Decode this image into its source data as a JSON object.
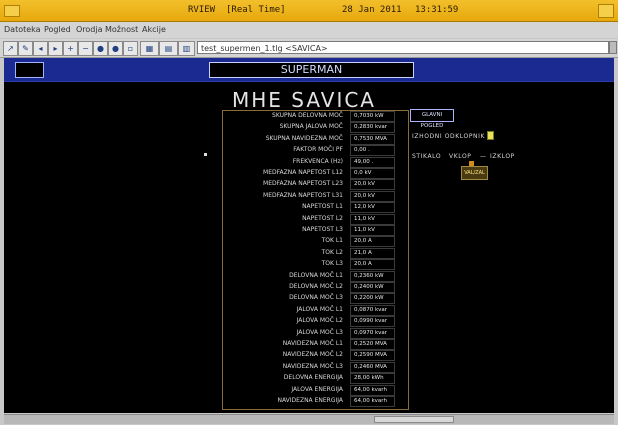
{
  "window": {
    "app": "RVIEW",
    "mode": "[Real Time]",
    "date": "28 Jan 2011",
    "time": "13:31:59"
  },
  "menu": [
    "Datoteka",
    "Pogled",
    "Orodja",
    "Možnost",
    "Akcije"
  ],
  "toolbar": {
    "path": "test_supermen_1.tlg <SAVICA>"
  },
  "header": {
    "banner": "SUPERMAN",
    "station_title": "MHE SAVICA"
  },
  "measurements": [
    {
      "label": "SKUPNA DELOVNA MOČ",
      "value": "0,7030 kW"
    },
    {
      "label": "SKUPNA JALOVA MOČ",
      "value": "0,2830 kvar"
    },
    {
      "label": "SKUPNA NAVIDEZNA MOČ",
      "value": "0,7530 MVA"
    },
    {
      "label": "FAKTOR MOČI PF",
      "value": "0,00 ."
    },
    {
      "label": "FREKVENCA (Hz)",
      "value": "49,00 ."
    },
    {
      "label": "MEDFAZNA NAPETOST L12",
      "value": "0,0 kV"
    },
    {
      "label": "MEDFAZNA NAPETOST L23",
      "value": "20,0 kV"
    },
    {
      "label": "MEDFAZNA NAPETOST L31",
      "value": "20,0 kV"
    },
    {
      "label": "NAPETOST L1",
      "value": "12,0 kV"
    },
    {
      "label": "NAPETOST L2",
      "value": "11,0 kV"
    },
    {
      "label": "NAPETOST L3",
      "value": "11,0 kV"
    },
    {
      "label": "TOK L1",
      "value": "20,0 A"
    },
    {
      "label": "TOK L2",
      "value": "21,0 A"
    },
    {
      "label": "TOK L3",
      "value": "20,0 A"
    },
    {
      "label": "DELOVNA MOČ L1",
      "value": "0,2360 kW"
    },
    {
      "label": "DELOVNA MOČ L2",
      "value": "0,2400 kW"
    },
    {
      "label": "DELOVNA MOČ L3",
      "value": "0,2200 kW"
    },
    {
      "label": "JALOVA MOČ L1",
      "value": "0,0870 kvar"
    },
    {
      "label": "JALOVA MOČ L2",
      "value": "0,0990 kvar"
    },
    {
      "label": "JALOVA MOČ L3",
      "value": "0,0970 kvar"
    },
    {
      "label": "NAVIDEZNA MOČ L1",
      "value": "0,2520 MVA"
    },
    {
      "label": "NAVIDEZNA MOČ L2",
      "value": "0,2590 MVA"
    },
    {
      "label": "NAVIDEZNA MOČ L3",
      "value": "0,2460 MVA"
    },
    {
      "label": "DELOVNA ENERGIJA",
      "value": "28,00 kWh"
    },
    {
      "label": "JALOVA ENERGIJA",
      "value": "64,00 kvarh"
    },
    {
      "label": "NAVIDEZNA ENERGIJA",
      "value": "64,00 kvarh"
    }
  ],
  "right_panel": {
    "main_view_button": "GLAVNI POGLED",
    "breaker_label": "IZHODNI ODKLOPNIK",
    "switch_label": "STIKALO",
    "switch_on": "VKLOP",
    "switch_sep": "—",
    "switch_off": "IZKLOP",
    "valzal_label": "VAL/ZAL"
  },
  "colors": {
    "titlebar": "#e7a80c",
    "view_background": "#000000",
    "top_band": "#1a2a90",
    "frame_border": "#8b6a3e",
    "indicator_yellow": "#e8e25a"
  }
}
